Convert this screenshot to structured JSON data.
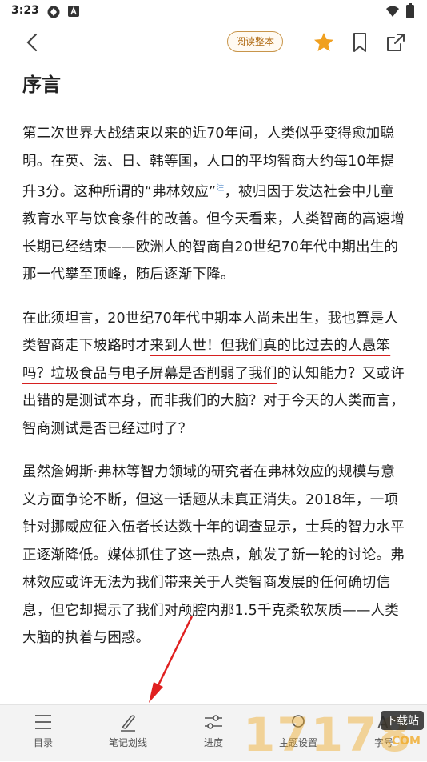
{
  "status_bar": {
    "time": "3:23"
  },
  "top_bar": {
    "read_all_label": "阅读整本"
  },
  "article": {
    "title": "序言",
    "paragraphs": [
      {
        "p1_a": "第二次世界大战结束以来的近70年间，人类似乎变得愈加聪明。在英、法、日、韩等国，人口的平均智商大约每10年提升3分。这种所谓的“弗林效应”",
        "note": "注",
        "p1_b": "，被归因于发达社会中儿童教育水平与饮食条件的改善。但今天看来，人类智商的高速增长期已经结束——欧洲人的智商自20世纪70年代中期出生的那一代攀至顶峰，随后逐渐下降。"
      },
      {
        "p2_a": "在此须坦言，20世纪70年代中期本人尚未出生，我也算是人类智商走下坡路时才",
        "p2_ul": "来到人世！但我们真的比过去的人愚笨吗？垃圾食品与电子屏幕是否削弱了我们",
        "p2_b": "的认知能力？又或许出错的是测试本身，而非我们的大脑？对于今天的人类而言，智商测试是否已经过时了？"
      },
      {
        "p3": "虽然詹姆斯·弗林等智力领域的研究者在弗林效应的规模与意义方面争论不断，但这一话题从未真正消失。2018年，一项针对挪威应征入伍者长达数十年的调查显示，士兵的智力水平正逐渐降低。媒体抓住了这一热点，触发了新一轮的讨论。弗林效应或许无法为我们带来关于人类智商发展的任何确切信息，但它却揭示了我们对颅腔内那1.5千克柔软灰质——人类大脑的执着与困惑。"
      }
    ]
  },
  "bottom_bar": {
    "items": [
      {
        "label": "目录",
        "icon": "list-icon"
      },
      {
        "label": "笔记划线",
        "icon": "pen-icon"
      },
      {
        "label": "进度",
        "icon": "slider-icon"
      },
      {
        "label": "主题设置",
        "icon": "theme-icon"
      },
      {
        "label": "字号",
        "icon": "font-icon"
      }
    ]
  },
  "watermark": {
    "digits": "17178",
    "badge": "下载站",
    "suffix": ".COM"
  },
  "colors": {
    "accent_orange": "#f0a020",
    "underline_red": "#d62020",
    "button_border": "#c8954a"
  }
}
